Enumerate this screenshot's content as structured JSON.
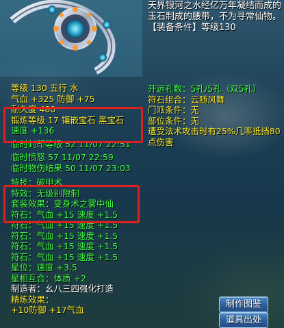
{
  "item": {
    "description": "天界银河之水经亿万年凝结而成的玉石制成的腰带，不为寻常仙物。",
    "requirement": "【装备条件】等级130"
  },
  "stats": {
    "level_line": "等级 130  五行 水",
    "hp_def_line": "气血 +325 防御 +75",
    "durability_line": "耐久度 480",
    "forge_line": "锻炼等级 17  镶嵌宝石 黑宝石",
    "speed_line": "速度 +136",
    "seal_level_line": "临时封印等级 52 11/07 22:51",
    "anger_line": "临时愤怒 57 11/07 22:59",
    "damage_line": "临时物伤结果 50 11/07 23:03",
    "skill_line": "特技：破甲术",
    "effect_line": "特效：无级别限制",
    "set_line": "套装效果：变身术之雾中仙",
    "rune_lines": [
      "符石：气血 +15 速度 +1.5",
      "符石：气血 +15 速度 +1.5",
      "符石：气血 +15 速度 +1.5",
      "符石：气血 +15 速度 +1.5",
      "符石：气血 +15 速度 +1.5"
    ],
    "star_line": "星位：速度 +3.5",
    "star_combo_line": "星相互合：体质 +2",
    "maker_line": "制造者：幺八三四强化打造",
    "refine_title": "精炼效果：",
    "refine_line": "+10防御 +17气血"
  },
  "rune_info": {
    "slots_line": "开运孔数：5孔/5孔（双5孔）",
    "combo_line": "符石组合：云随风舞",
    "school_line": "门派条件：无",
    "part_line": "部位条件：无",
    "effect_line": "遭受法术攻击时有25%几率抵挡80点伤害"
  },
  "buttons": {
    "illustration": "制作图鉴",
    "exit": "道具出处"
  },
  "colors": {
    "yellow": "#f7e62d",
    "green": "#41ff41",
    "white": "#ffffff",
    "highlight_box": "#e0201f"
  }
}
